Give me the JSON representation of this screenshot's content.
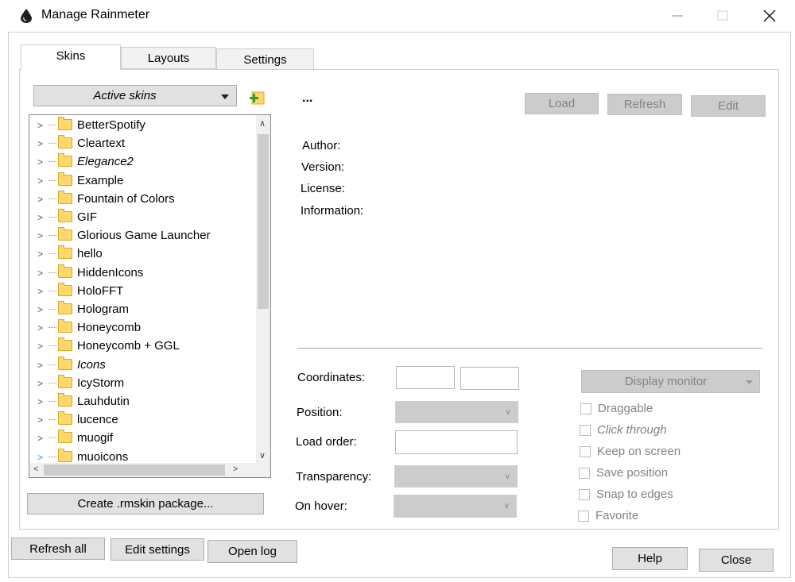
{
  "window": {
    "title": "Manage Rainmeter"
  },
  "tabs": [
    {
      "label": "Skins"
    },
    {
      "label": "Layouts"
    },
    {
      "label": "Settings"
    }
  ],
  "skins": {
    "filter": "Active skins",
    "list": [
      "BetterSpotify",
      "Cleartext",
      "Elegance2",
      "Example",
      "Fountain of Colors",
      "GIF",
      "Glorious Game Launcher",
      "hello",
      "HiddenIcons",
      "HoloFFT",
      "Hologram",
      "Honeycomb",
      "Honeycomb + GGL",
      "Icons",
      "IcyStorm",
      "Lauhdutin",
      "lucence",
      "muogif",
      "muoicons"
    ],
    "create_package": "Create .rmskin package...",
    "selected_name": "...",
    "load": "Load",
    "refresh": "Refresh",
    "edit": "Edit",
    "info": {
      "author": "Author:",
      "version": "Version:",
      "license": "License:",
      "information": "Information:"
    },
    "settings": {
      "coordinates": "Coordinates:",
      "position": "Position:",
      "load_order": "Load order:",
      "transparency": "Transparency:",
      "on_hover": "On hover:",
      "display_monitor": "Display monitor"
    },
    "checkboxes": [
      "Draggable",
      "Click through",
      "Keep on screen",
      "Save position",
      "Snap to edges",
      "Favorite"
    ]
  },
  "footer": {
    "refresh_all": "Refresh all",
    "edit_settings": "Edit settings",
    "open_log": "Open log",
    "help": "Help",
    "close": "Close"
  }
}
